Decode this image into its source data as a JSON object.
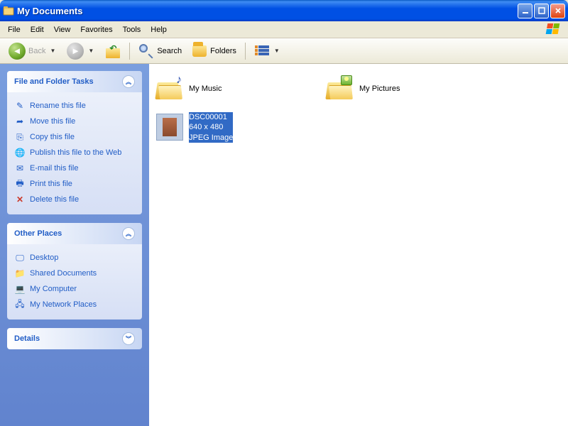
{
  "window": {
    "title": "My Documents"
  },
  "menu": {
    "file": "File",
    "edit": "Edit",
    "view": "View",
    "favorites": "Favorites",
    "tools": "Tools",
    "help": "Help"
  },
  "toolbar": {
    "back": "Back",
    "search": "Search",
    "folders": "Folders"
  },
  "sidebar": {
    "tasks": {
      "title": "File and Folder Tasks",
      "rename": "Rename this file",
      "move": "Move this file",
      "copy": "Copy this file",
      "publish": "Publish this file to the Web",
      "email": "E-mail this file",
      "print": "Print this file",
      "delete": "Delete this file"
    },
    "places": {
      "title": "Other Places",
      "desktop": "Desktop",
      "shared": "Shared Documents",
      "computer": "My Computer",
      "network": "My Network Places"
    },
    "details": {
      "title": "Details"
    }
  },
  "items": {
    "music": "My Music",
    "pictures": "My Pictures",
    "selected": {
      "name": "DSC00001",
      "dims": "640 x 480",
      "type": "JPEG Image"
    }
  }
}
